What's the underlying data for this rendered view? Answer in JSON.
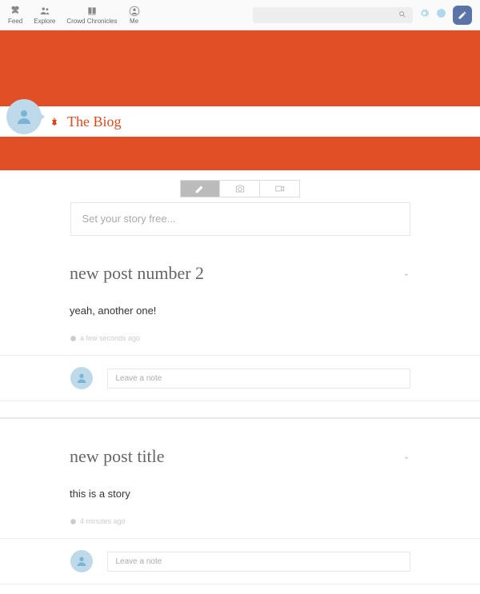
{
  "colors": {
    "accent": "#e04f26",
    "compose_btn": "#5a74a8",
    "link_icon": "#b0d8ec"
  },
  "nav": {
    "items": [
      {
        "label": "Feed",
        "icon": "butterfly"
      },
      {
        "label": "Explore",
        "icon": "people"
      },
      {
        "label": "Crowd Chronicles",
        "icon": "book"
      },
      {
        "label": "Me",
        "icon": "user-circle"
      }
    ],
    "search": {
      "placeholder": ""
    }
  },
  "blog": {
    "title": "The Biog"
  },
  "composer": {
    "tabs": [
      {
        "icon": "pencil",
        "name": "text",
        "active": true
      },
      {
        "icon": "camera",
        "name": "photo",
        "active": false
      },
      {
        "icon": "video",
        "name": "video",
        "active": false
      }
    ],
    "placeholder": "Set your story free..."
  },
  "posts": [
    {
      "title": "new post number 2",
      "body": "yeah, another one!",
      "meta": "a few seconds ago",
      "note_placeholder": "Leave a note"
    },
    {
      "title": "new post title",
      "body": "this is a story",
      "meta": "4 minutes ago",
      "note_placeholder": "Leave a note"
    }
  ]
}
